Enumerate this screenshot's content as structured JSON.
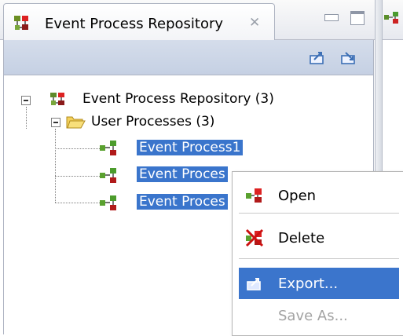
{
  "window": {
    "tab_title": "Event Process Repository",
    "close_glyph": "✕",
    "minimize_icon": "minimize-icon",
    "maximize_icon": "maximize-icon"
  },
  "toolbar": {
    "buttons": [
      {
        "name": "export-icon"
      },
      {
        "name": "import-icon"
      }
    ]
  },
  "tree": {
    "root": "Event Process Repository (3)",
    "folder": "User Processes (3)",
    "items": [
      "Event Process1",
      "Event Proces",
      "Event Proces"
    ]
  },
  "context_menu": {
    "items": [
      {
        "label": "Open"
      },
      {
        "label": "Delete"
      },
      {
        "label": "Export..."
      },
      {
        "label": "Save As..."
      }
    ]
  },
  "colors": {
    "selection": "#3a75cc",
    "disabled": "#a3a3a3"
  }
}
